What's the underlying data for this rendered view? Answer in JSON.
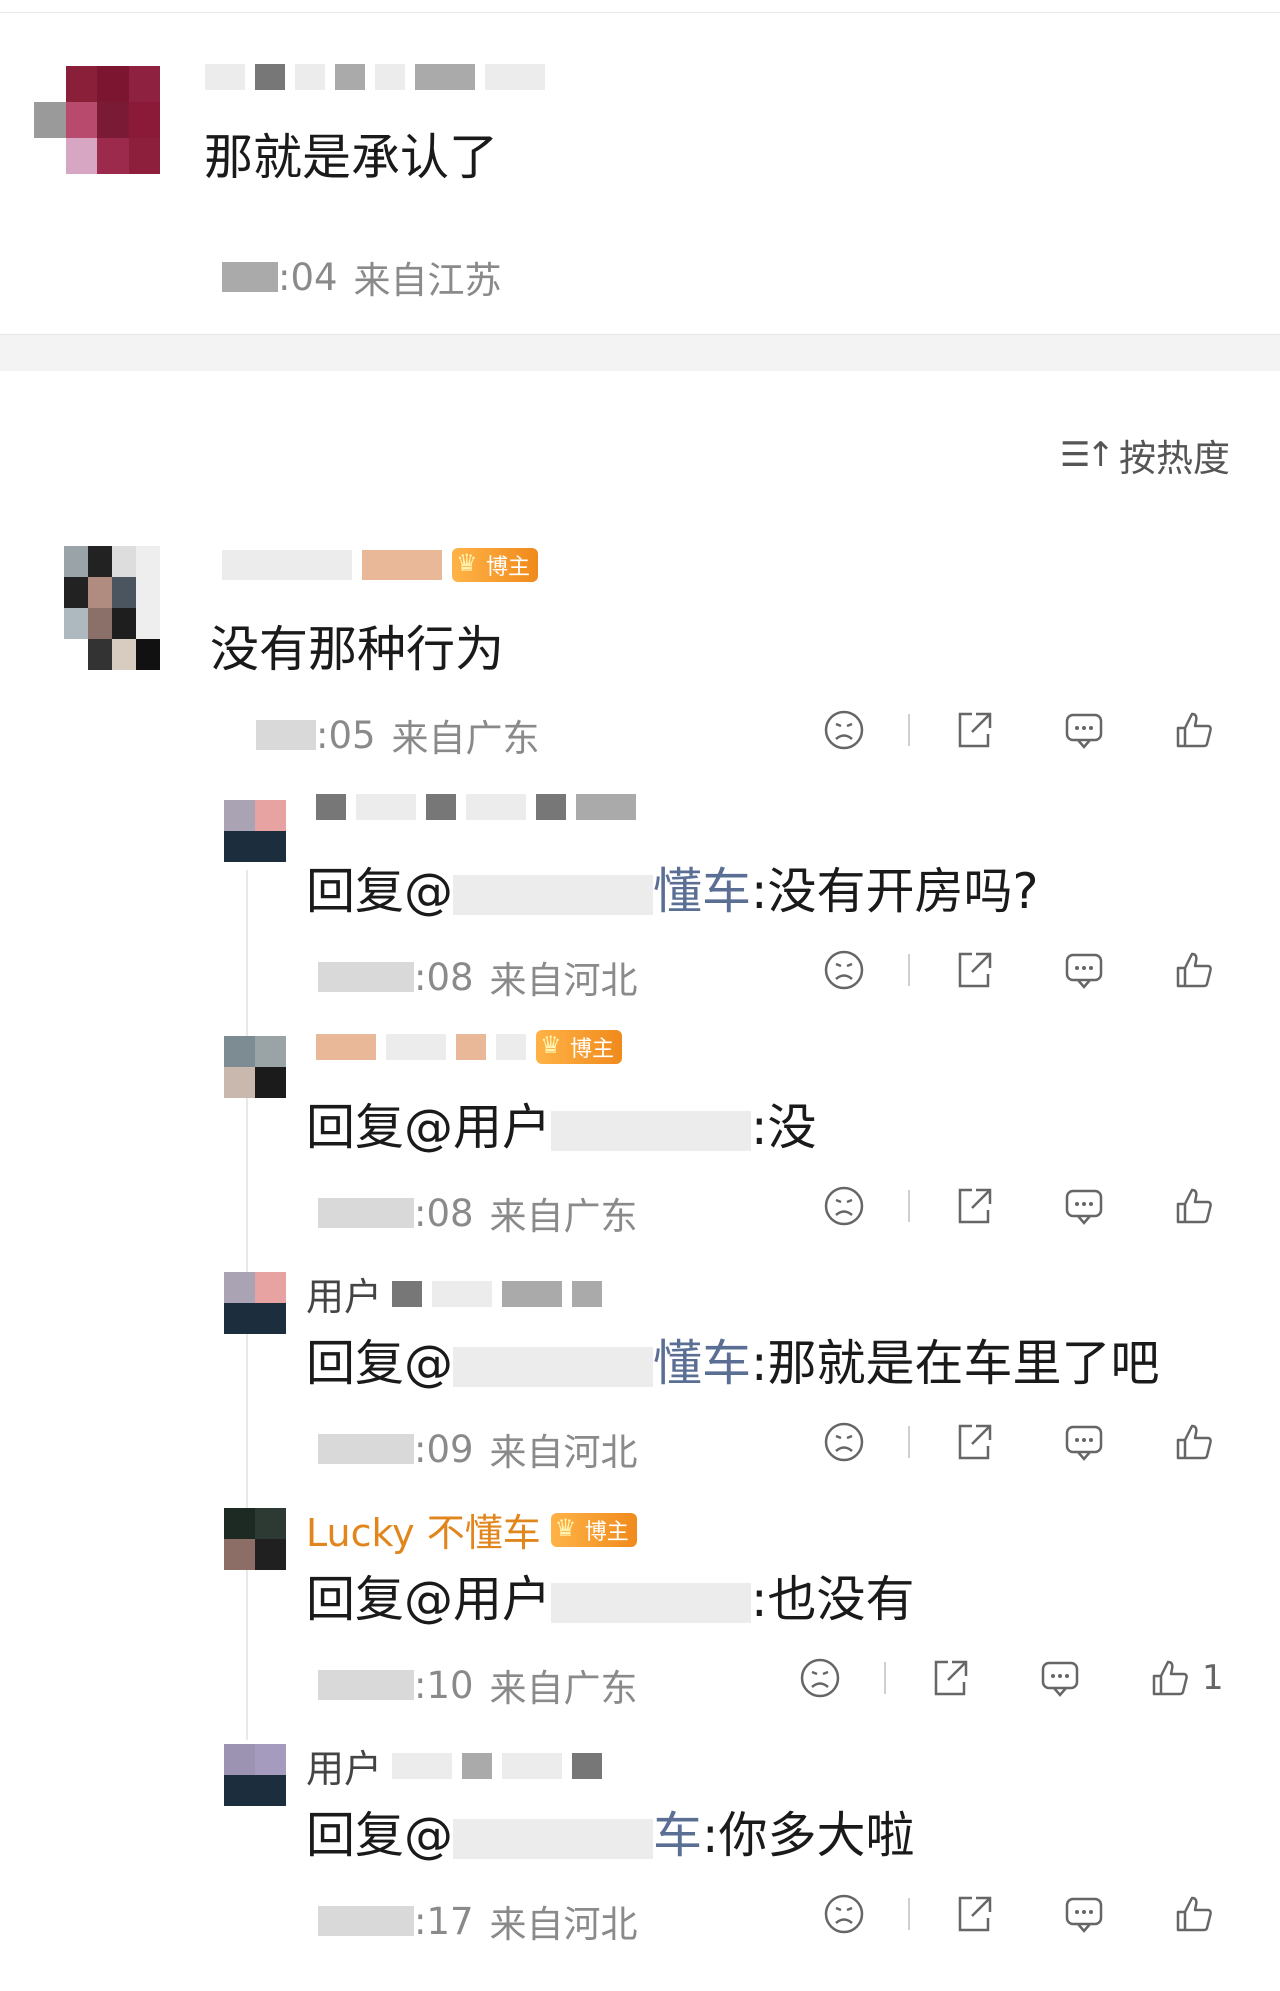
{
  "original_post": {
    "text": "那就是承认了",
    "time": ":04",
    "location": "来自江苏"
  },
  "sort": {
    "label": "按热度",
    "icon": "sort-icon"
  },
  "comments": [
    {
      "badge": "博主",
      "text": "没有那种行为",
      "time": ":05",
      "location": "来自广东"
    }
  ],
  "replies": [
    {
      "name": "",
      "badge": "",
      "prefix": "回复@",
      "mention": "懂车",
      "text": ":没有开房吗?",
      "time": ":08",
      "location": "来自河北",
      "likes": ""
    },
    {
      "name": "",
      "badge": "博主",
      "prefix": "回复@用户",
      "mention": "",
      "text": ":没",
      "time": ":08",
      "location": "来自广东",
      "likes": ""
    },
    {
      "name": "用户",
      "badge": "",
      "prefix": "回复@",
      "mention": "懂车",
      "text": ":那就是在车里了吧",
      "time": ":09",
      "location": "来自河北",
      "likes": ""
    },
    {
      "name": "Lucky 不懂车",
      "badge": "博主",
      "prefix": "回复@用户",
      "mention": "",
      "text": ":也没有",
      "time": ":10",
      "location": "来自广东",
      "likes": "1"
    },
    {
      "name": "用户",
      "badge": "",
      "prefix": "回复@",
      "mention": "车",
      "text": ":你多大啦",
      "time": ":17",
      "location": "来自河北",
      "likes": ""
    }
  ],
  "icons": {
    "dislike": "frown-icon",
    "share": "share-icon",
    "comment": "comment-icon",
    "like": "thumbs-up-icon",
    "crown": "crown-icon"
  },
  "colors": {
    "accent_orange": "#e0861c",
    "mention_blue": "#5b6f94",
    "meta_gray": "#8a8a8a",
    "separator": "#f3f3f3"
  }
}
